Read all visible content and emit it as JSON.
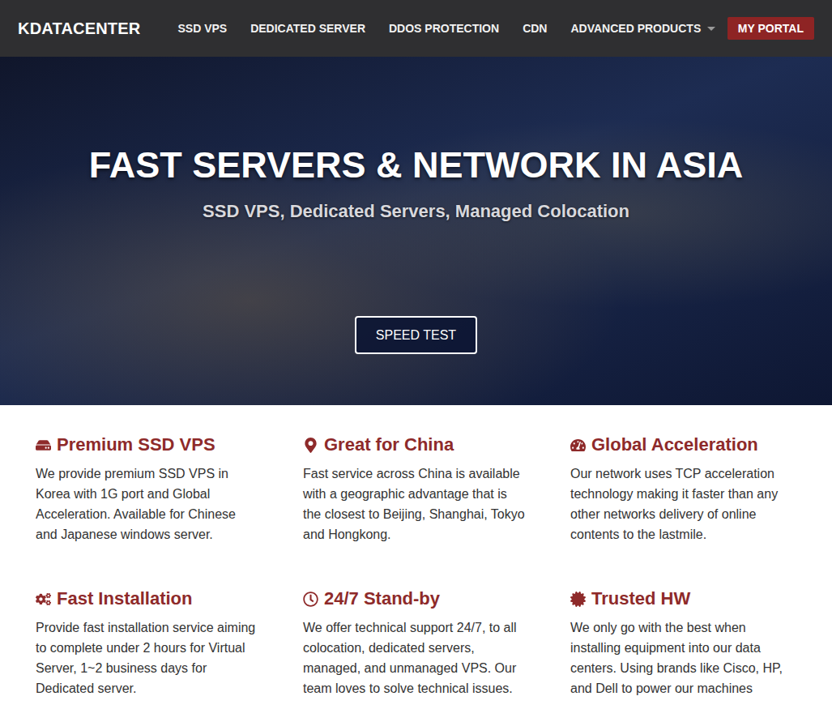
{
  "header": {
    "logo": "KDATACENTER",
    "nav": [
      {
        "label": "SSD VPS",
        "dropdown": false
      },
      {
        "label": "DEDICATED SERVER",
        "dropdown": false
      },
      {
        "label": "DDOS PROTECTION",
        "dropdown": false
      },
      {
        "label": "CDN",
        "dropdown": false
      },
      {
        "label": "ADVANCED PRODUCTS",
        "dropdown": true
      }
    ],
    "portal_button": "MY PORTAL"
  },
  "hero": {
    "title": "FAST SERVERS & NETWORK IN ASIA",
    "subtitle": "SSD VPS, Dedicated Servers, Managed Colocation",
    "button": "SPEED TEST"
  },
  "features": [
    {
      "title": "Premium SSD VPS",
      "text": "We provide premium SSD VPS in Korea with 1G port and Global Acceleration. Available for Chinese and Japanese windows server."
    },
    {
      "title": "Great for China",
      "text": "Fast service across China is available with a geographic advantage that is the closest to Beijing, Shanghai, Tokyo and Hongkong."
    },
    {
      "title": "Global Acceleration",
      "text": "Our network uses TCP acceleration technology making it faster than any other networks delivery of online contents to the lastmile."
    },
    {
      "title": "Fast Installation",
      "text": "Provide fast installation service aiming to complete under 2 hours for Virtual Server, 1~2 business days for Dedicated server."
    },
    {
      "title": "24/7 Stand-by",
      "text": "We offer technical support 24/7, to all colocation, dedicated servers, managed, and unmanaged VPS. Our team loves to solve technical issues."
    },
    {
      "title": "Trusted HW",
      "text": "We only go with the best when installing equipment into our data centers. Using brands like Cisco, HP, and Dell to power our machines"
    }
  ]
}
